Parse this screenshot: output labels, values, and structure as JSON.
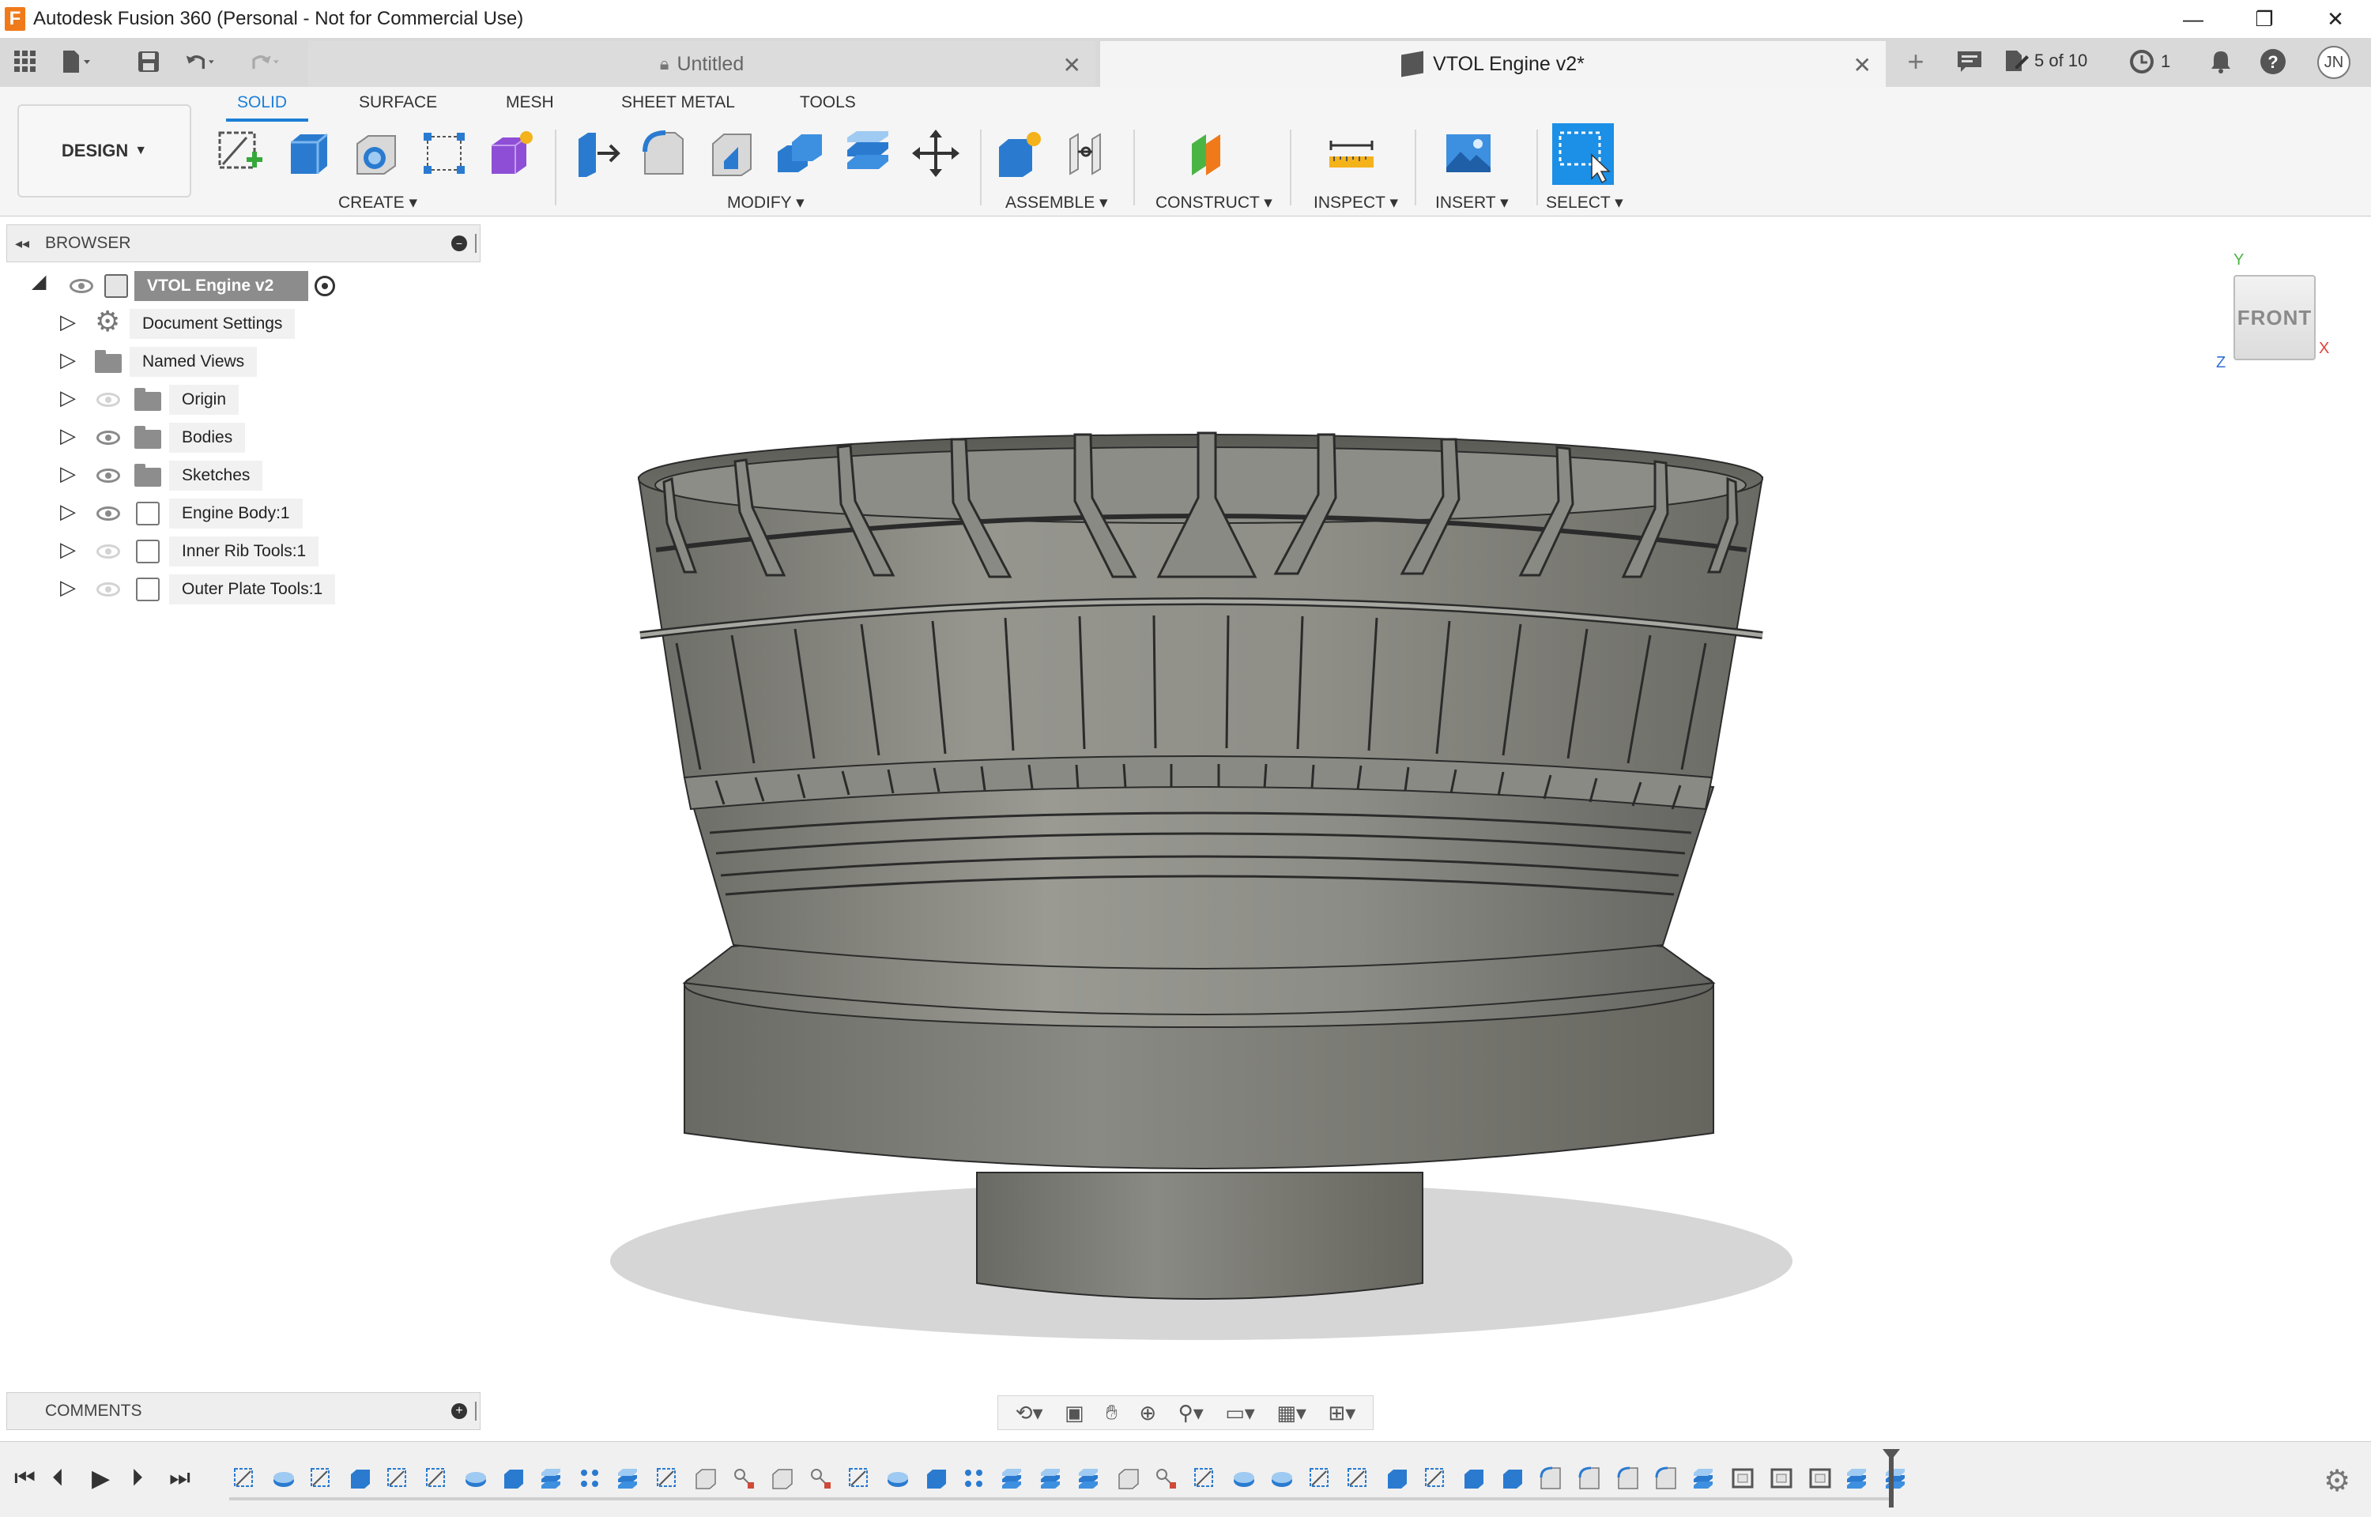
{
  "window": {
    "title": "Autodesk Fusion 360 (Personal - Not for Commercial Use)",
    "logo_letter": "F",
    "minimize_glyph": "—",
    "restore_glyph": "❐",
    "close_glyph": "✕"
  },
  "tabs": {
    "items": [
      {
        "label": "Untitled",
        "active": false,
        "locked": true
      },
      {
        "label": "VTOL Engine v2*",
        "active": true,
        "locked": false
      }
    ],
    "close_glyph": "✕",
    "new_tab_glyph": "+",
    "job_status": "5 of 10",
    "notifications_count": "1",
    "user_initials": "JN"
  },
  "toolbar": {
    "workspace": "DESIGN",
    "workspace_tabs": [
      "SOLID",
      "SURFACE",
      "MESH",
      "SHEET METAL",
      "TOOLS"
    ],
    "active_workspace_tab": "SOLID",
    "groups": [
      "CREATE",
      "MODIFY",
      "ASSEMBLE",
      "CONSTRUCT",
      "INSPECT",
      "INSERT",
      "SELECT"
    ]
  },
  "browser": {
    "title": "BROWSER",
    "root": "VTOL Engine v2",
    "items": [
      {
        "label": "Document Settings",
        "icon": "gear-icon",
        "visible": null
      },
      {
        "label": "Named Views",
        "icon": "folder-icon",
        "visible": null
      },
      {
        "label": "Origin",
        "icon": "folder-icon",
        "visible": false
      },
      {
        "label": "Bodies",
        "icon": "folder-icon",
        "visible": true
      },
      {
        "label": "Sketches",
        "icon": "folder-icon",
        "visible": true
      },
      {
        "label": "Engine Body:1",
        "icon": "component-icon",
        "visible": true
      },
      {
        "label": "Inner Rib Tools:1",
        "icon": "component-icon",
        "visible": false
      },
      {
        "label": "Outer Plate Tools:1",
        "icon": "component-icon",
        "visible": false
      }
    ]
  },
  "viewcube": {
    "face": "FRONT",
    "axis_x": "X",
    "axis_y": "Y",
    "axis_z": "Z"
  },
  "comments": {
    "title": "COMMENTS"
  },
  "colors": {
    "accent": "#1c7fd6",
    "model_body": "#8a8a84",
    "model_dark": "#5e5e58",
    "shadow": "#d4d4d4",
    "select_tool": "#1c8fe6"
  }
}
